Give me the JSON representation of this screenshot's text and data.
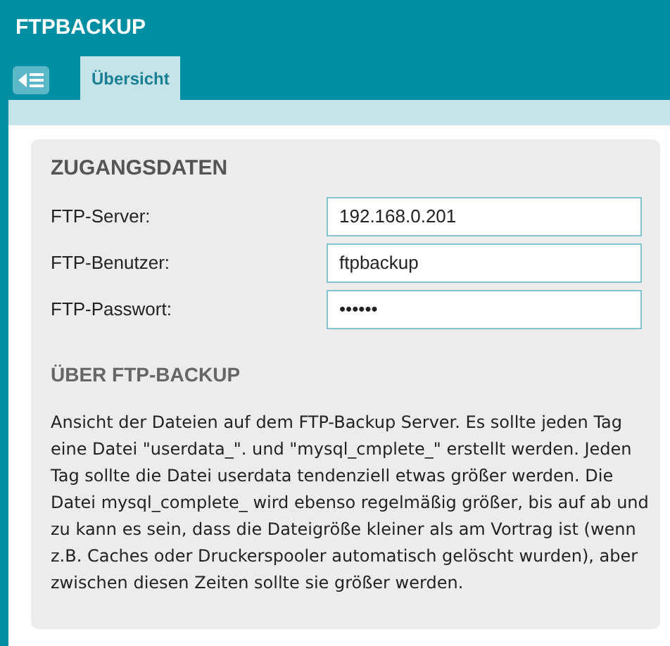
{
  "header": {
    "title": "FTPBACKUP"
  },
  "tabs": [
    {
      "label": "Übersicht",
      "selected": true
    }
  ],
  "credentials": {
    "heading": "ZUGANGSDATEN",
    "fields": [
      {
        "label": "FTP-Server:",
        "value": "192.168.0.201"
      },
      {
        "label": "FTP-Benutzer:",
        "value": "ftpbackup"
      },
      {
        "label": "FTP-Passwort:",
        "value": "••••••"
      }
    ]
  },
  "about": {
    "heading": "ÜBER FTP-BACKUP",
    "text": "Ansicht der Dateien auf dem FTP-Backup Server. Es sollte jeden Tag eine Datei \"userdata_\". und \"mysql_cmplete_\" erstellt werden. Jeden Tag sollte die Datei userdata tendenziell etwas größer werden. Die Datei mysql_complete_ wird ebenso regelmäßig größer, bis auf ab und zu kann es sein, dass die Dateigröße kleiner als am Vortrag ist (wenn z.B. Caches oder Druckerspooler automatisch gelöscht wurden), aber zwischen diesen Zeiten sollte sie größer werden."
  }
}
